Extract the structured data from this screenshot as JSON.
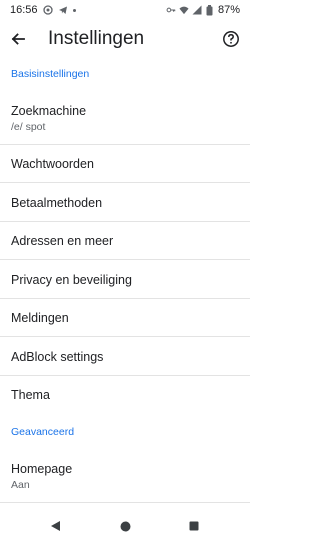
{
  "status_bar": {
    "time": "16:56",
    "battery": "87%"
  },
  "header": {
    "title": "Instellingen"
  },
  "sections": [
    {
      "header": "Basisinstellingen"
    },
    {
      "header": "Geavanceerd"
    }
  ],
  "items": [
    {
      "label": "Zoekmachine",
      "sub": "/e/ spot"
    },
    {
      "label": "Wachtwoorden"
    },
    {
      "label": "Betaalmethoden"
    },
    {
      "label": "Adressen en meer"
    },
    {
      "label": "Privacy en beveiliging"
    },
    {
      "label": "Meldingen"
    },
    {
      "label": "AdBlock settings"
    },
    {
      "label": "Thema"
    },
    {
      "label": "Homepage",
      "sub": "Aan"
    }
  ],
  "icons": {
    "back": "arrow-back-icon",
    "help": "help-circle-icon",
    "nav_back": "triangle-back-icon",
    "nav_home": "circle-home-icon",
    "nav_recents": "square-recents-icon"
  },
  "colors": {
    "accent": "#1a73e8",
    "text": "#202124",
    "subtext": "#5f6368",
    "divider": "#e3e3e3"
  }
}
